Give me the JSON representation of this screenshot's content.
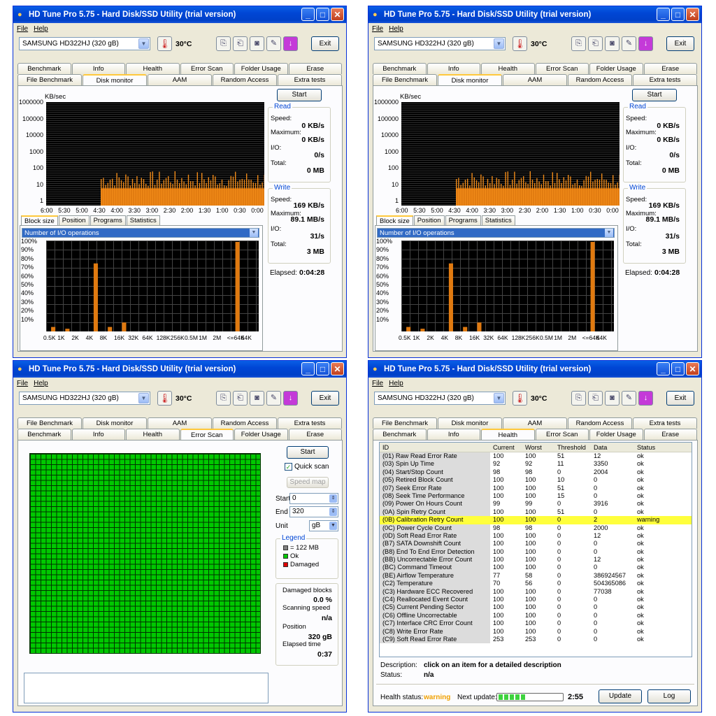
{
  "window": {
    "title": "HD Tune Pro 5.75 - Hard Disk/SSD Utility (trial version)",
    "menu_file": "File",
    "menu_help": "Help",
    "drive": "SAMSUNG HD322HJ (320 gB)",
    "temperature": "30°C",
    "exit": "Exit"
  },
  "tabs_top": [
    "Benchmark",
    "Info",
    "Health",
    "Error Scan",
    "Folder Usage",
    "Erase"
  ],
  "tabs_bottom": [
    "File Benchmark",
    "Disk monitor",
    "AAM",
    "Random Access",
    "Extra tests"
  ],
  "monitor": {
    "start": "Start",
    "unit": "KB/sec",
    "yticks": [
      "1000000",
      "100000",
      "10000",
      "1000",
      "100",
      "10",
      "1"
    ],
    "xticks": [
      "6:00",
      "5:30",
      "5:00",
      "4:30",
      "4:00",
      "3:30",
      "3:00",
      "2:30",
      "2:00",
      "1:30",
      "1:00",
      "0:30",
      "0:00"
    ],
    "read": {
      "legend": "Read",
      "speed_label": "Speed:",
      "speed": "0 KB/s",
      "max_label": "Maximum:",
      "max": "0 KB/s",
      "io_label": "I/O:",
      "io": "0/s",
      "total_label": "Total:",
      "total": "0 MB"
    },
    "write": {
      "legend": "Write",
      "speed_label": "Speed:",
      "speed": "169 KB/s",
      "max_label": "Maximum:",
      "max": "89.1 MB/s",
      "io_label": "I/O:",
      "io": "31/s",
      "total_label": "Total:",
      "total": "3 MB"
    },
    "elapsed_label": "Elapsed:",
    "elapsed": "0:04:28",
    "subtabs": [
      "Block size",
      "Position",
      "Programs",
      "Statistics"
    ],
    "selector": "Number of I/O operations",
    "pct_ticks": [
      "100%",
      "90%",
      "80%",
      "70%",
      "60%",
      "50%",
      "40%",
      "30%",
      "20%",
      "10%"
    ],
    "block_labels": [
      "0.5K",
      "1K",
      "2K",
      "4K",
      "8K",
      "16K",
      "32K",
      "64K",
      "128K",
      "256K",
      "0.5M",
      "1M",
      "2M",
      "<=64K",
      "64K"
    ]
  },
  "chart_data": [
    {
      "type": "bar",
      "title": "Number of I/O operations",
      "ylabel": "",
      "ylim": [
        0,
        100
      ],
      "categories": [
        "0.5K",
        "1K",
        "2K",
        "4K",
        "8K",
        "16K",
        "32K",
        "64K",
        "128K",
        "256K",
        "0.5M",
        "1M",
        "2M",
        "<=64K",
        "64K"
      ],
      "values": [
        5,
        3,
        0,
        76,
        5,
        10,
        0,
        0,
        0,
        0,
        0,
        0,
        0,
        100,
        0
      ]
    },
    {
      "type": "area",
      "title": "",
      "ylabel": "KB/sec",
      "yscale": "log",
      "ylim": [
        1,
        1000000
      ],
      "x": [
        "6:00",
        "5:30",
        "5:00",
        "4:30",
        "4:00",
        "3:30",
        "3:00",
        "2:30",
        "2:00",
        "1:30",
        "1:00",
        "0:30",
        "0:00"
      ],
      "series": [
        {
          "name": "Write",
          "values": [
            0,
            0,
            0,
            100,
            100,
            100,
            100,
            100,
            100,
            100,
            100,
            100,
            100
          ]
        }
      ]
    }
  ],
  "scan": {
    "start": "Start",
    "quick_scan": "Quick scan",
    "speed_map": "Speed map",
    "start_label": "Start",
    "start_val": "0",
    "end_label": "End",
    "end_val": "320",
    "unit_label": "Unit",
    "unit_val": "gB",
    "legend": "Legend",
    "leg1": "= 122 MB",
    "leg2": "Ok",
    "leg3": "Damaged",
    "damaged_label": "Damaged blocks",
    "damaged": "0.0 %",
    "speed_label": "Scanning speed",
    "speed": "n/a",
    "pos_label": "Position",
    "pos": "320 gB",
    "elapsed_label": "Elapsed time",
    "elapsed": "0:37"
  },
  "health": {
    "columns": [
      "ID",
      "Current",
      "Worst",
      "Threshold",
      "Data",
      "Status"
    ],
    "rows": [
      [
        "(01) Raw Read Error Rate",
        "100",
        "100",
        "51",
        "12",
        "ok"
      ],
      [
        "(03) Spin Up Time",
        "92",
        "92",
        "11",
        "3350",
        "ok"
      ],
      [
        "(04) Start/Stop Count",
        "98",
        "98",
        "0",
        "2004",
        "ok"
      ],
      [
        "(05) Retired Block Count",
        "100",
        "100",
        "10",
        "0",
        "ok"
      ],
      [
        "(07) Seek Error Rate",
        "100",
        "100",
        "51",
        "0",
        "ok"
      ],
      [
        "(08) Seek Time Performance",
        "100",
        "100",
        "15",
        "0",
        "ok"
      ],
      [
        "(09) Power On Hours Count",
        "99",
        "99",
        "0",
        "3916",
        "ok"
      ],
      [
        "(0A) Spin Retry Count",
        "100",
        "100",
        "51",
        "0",
        "ok"
      ],
      [
        "(0B) Calibration Retry Count",
        "100",
        "100",
        "0",
        "2",
        "warning"
      ],
      [
        "(0C) Power Cycle Count",
        "98",
        "98",
        "0",
        "2000",
        "ok"
      ],
      [
        "(0D) Soft Read Error Rate",
        "100",
        "100",
        "0",
        "12",
        "ok"
      ],
      [
        "(B7) SATA Downshift Count",
        "100",
        "100",
        "0",
        "0",
        "ok"
      ],
      [
        "(B8) End To End Error Detection",
        "100",
        "100",
        "0",
        "0",
        "ok"
      ],
      [
        "(BB) Uncorrectable Error Count",
        "100",
        "100",
        "0",
        "12",
        "ok"
      ],
      [
        "(BC) Command Timeout",
        "100",
        "100",
        "0",
        "0",
        "ok"
      ],
      [
        "(BE) Airflow Temperature",
        "77",
        "58",
        "0",
        "386924567",
        "ok"
      ],
      [
        "(C2) Temperature",
        "70",
        "56",
        "0",
        "504365086",
        "ok"
      ],
      [
        "(C3) Hardware ECC Recovered",
        "100",
        "100",
        "0",
        "77038",
        "ok"
      ],
      [
        "(C4) Reallocated Event Count",
        "100",
        "100",
        "0",
        "0",
        "ok"
      ],
      [
        "(C5) Current Pending Sector",
        "100",
        "100",
        "0",
        "0",
        "ok"
      ],
      [
        "(C6) Offline Uncorrectable",
        "100",
        "100",
        "0",
        "0",
        "ok"
      ],
      [
        "(C7) Interface CRC Error Count",
        "100",
        "100",
        "0",
        "0",
        "ok"
      ],
      [
        "(C8) Write Error Rate",
        "100",
        "100",
        "0",
        "0",
        "ok"
      ],
      [
        "(C9) Soft Read Error Rate",
        "253",
        "253",
        "0",
        "0",
        "ok"
      ]
    ],
    "desc_label": "Description:",
    "desc": "click on an item for a detailed description",
    "status_label": "Status:",
    "status": "n/a",
    "health_label": "Health status:",
    "health_val": "warning",
    "next_label": "Next update:",
    "next_val": "2:55",
    "update": "Update",
    "log": "Log"
  }
}
